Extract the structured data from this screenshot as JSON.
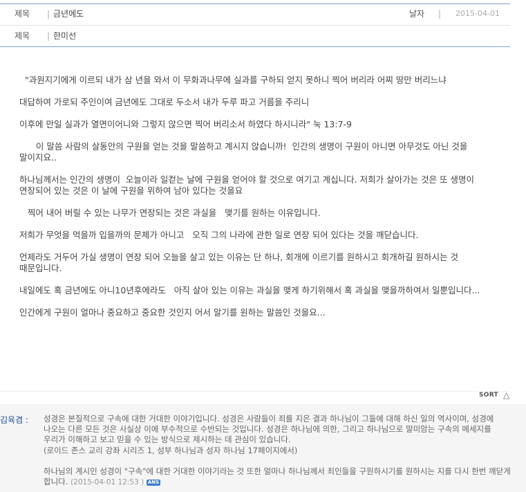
{
  "post": {
    "subject_label": "제목",
    "subject_value": "금년에도",
    "date_label": "날자",
    "date_value": "2015-04-01",
    "author_label": "제목",
    "author_value": "한미선",
    "separator": "|"
  },
  "body": {
    "paragraphs": [
      "  \"과원지기에게 이르되 내가 삼 년을 와서 이 무화과나무에 실과를 구하되 얻지 못하니 찍어 버리라 어찌 땅만 버리느냐",
      "대답하여 가로되 주인이여 금년에도 그대로 두소서 내가 두루 파고 거름을 주리니",
      "이후에 만일 실과가 열면이어니와 그렇지 않으면 찍어 버리소서 하였다 하시니라\" 눅 13:7-9",
      "      이 말씀 사람의 살동안의 구원을 얻는 것을 말씀하고 계시지 않습니까!  인간의 생명이 구원이 아니면 아무것도 아닌 것을 말이지요..",
      "하나님께서는 인간의 생명이  오늘이라 일컫는 날에 구원을 얻어야 할 것으로 여기고 계십니다. 저희가 살아가는 것은 또 생명이 연장되어 있는 것은 이 날에 구원을 위하여 남아 있다는 것을요",
      "   찍어 내어 버릴 수 있는 나무가 연장되는 것은 과실을   맺기를 원하는 이유입니다.",
      "저희가 무엇을 먹을까 입을까의 문제가 아니고   오직 그의 나라에 관한 일로 연장 되어 있다는 것을 깨닫습니다.",
      "언제라도 거두어 가실 생명이 연장 되어 오늘을 살고 있는 이유는 단 하나, 회개에 이르기를 원하시고 회개하길 원하시는 것 때문입니다.",
      "내일에도 혹 금년에도 아니10년후에라도   아직 살아 있는 이유는 과실을 맺게 하기위해서 혹 과실을 맺을까하여서 일뿐입니다...",
      "인간에게 구원이 얼마나 중요하고 중요한 것인지 어서 알기를 원하는 말씀인 것을요..."
    ]
  },
  "sort": {
    "label": "SORT",
    "icon": "triangle-up-icon",
    "arrow": "△"
  },
  "comment": {
    "author": "김육겸 :",
    "line1": "성경은 본질적으로 구속에 대한 거대한 이야기입니다. 성경은 사람들이 죄를 지은 결과 하나님이 그들에 대해 하신 일의 역사이며, 성경에 나오는 다른 모든 것은 사실상 이에 부수적으로 수반되는 것입니다. 성경은 하나님에 의한, 그리고 하나님으로 말미암는 구속의 메세지를 우리가 이해하고 보고 믿을 수 있는 방식으로 제시하는 데 관심이 있습니다.",
    "line2": "(로이드 존스 교리 강좌 시리즈 1, 성부 하나님과 성자 하나님 17페이지에서)",
    "line3": "하나님의 계시인 성경이 \"구속\"에 대한 거대한 이야기라는 것 또한 얼마나 하나님께서 죄인들을 구원하시기를 원하시는 지를 다시 한번 깨닫게 합니다.",
    "date": "(2015-04-01 12:53  )",
    "badge": "ANS"
  },
  "colors": {
    "rule_blue": "#7f9fd2",
    "author_blue": "#1f4e9e",
    "badge_blue": "#3a7fd0",
    "comment_bg": "#f5f5f5"
  }
}
